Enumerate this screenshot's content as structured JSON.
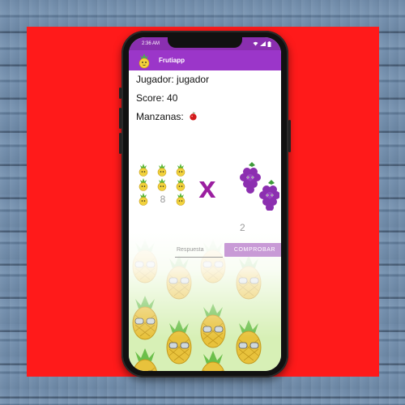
{
  "status_bar": {
    "time": "2:36 AM"
  },
  "app": {
    "title": "Frutiapp"
  },
  "info": {
    "player_label": "Jugador: jugador",
    "score_label": "Score: 40",
    "apples_label": "Manzanas:"
  },
  "operation": {
    "operand1": "8",
    "operator": "x",
    "operand2": "2"
  },
  "answer": {
    "placeholder": "Respuesta"
  },
  "check_button": {
    "label": "COMPROBAR"
  },
  "colors": {
    "status_bar": "#8a2fb0",
    "app_bar": "#9b36c9",
    "operator": "#9b1fa0",
    "button": "#c89ad6",
    "background_panel": "#ff1a1a"
  }
}
